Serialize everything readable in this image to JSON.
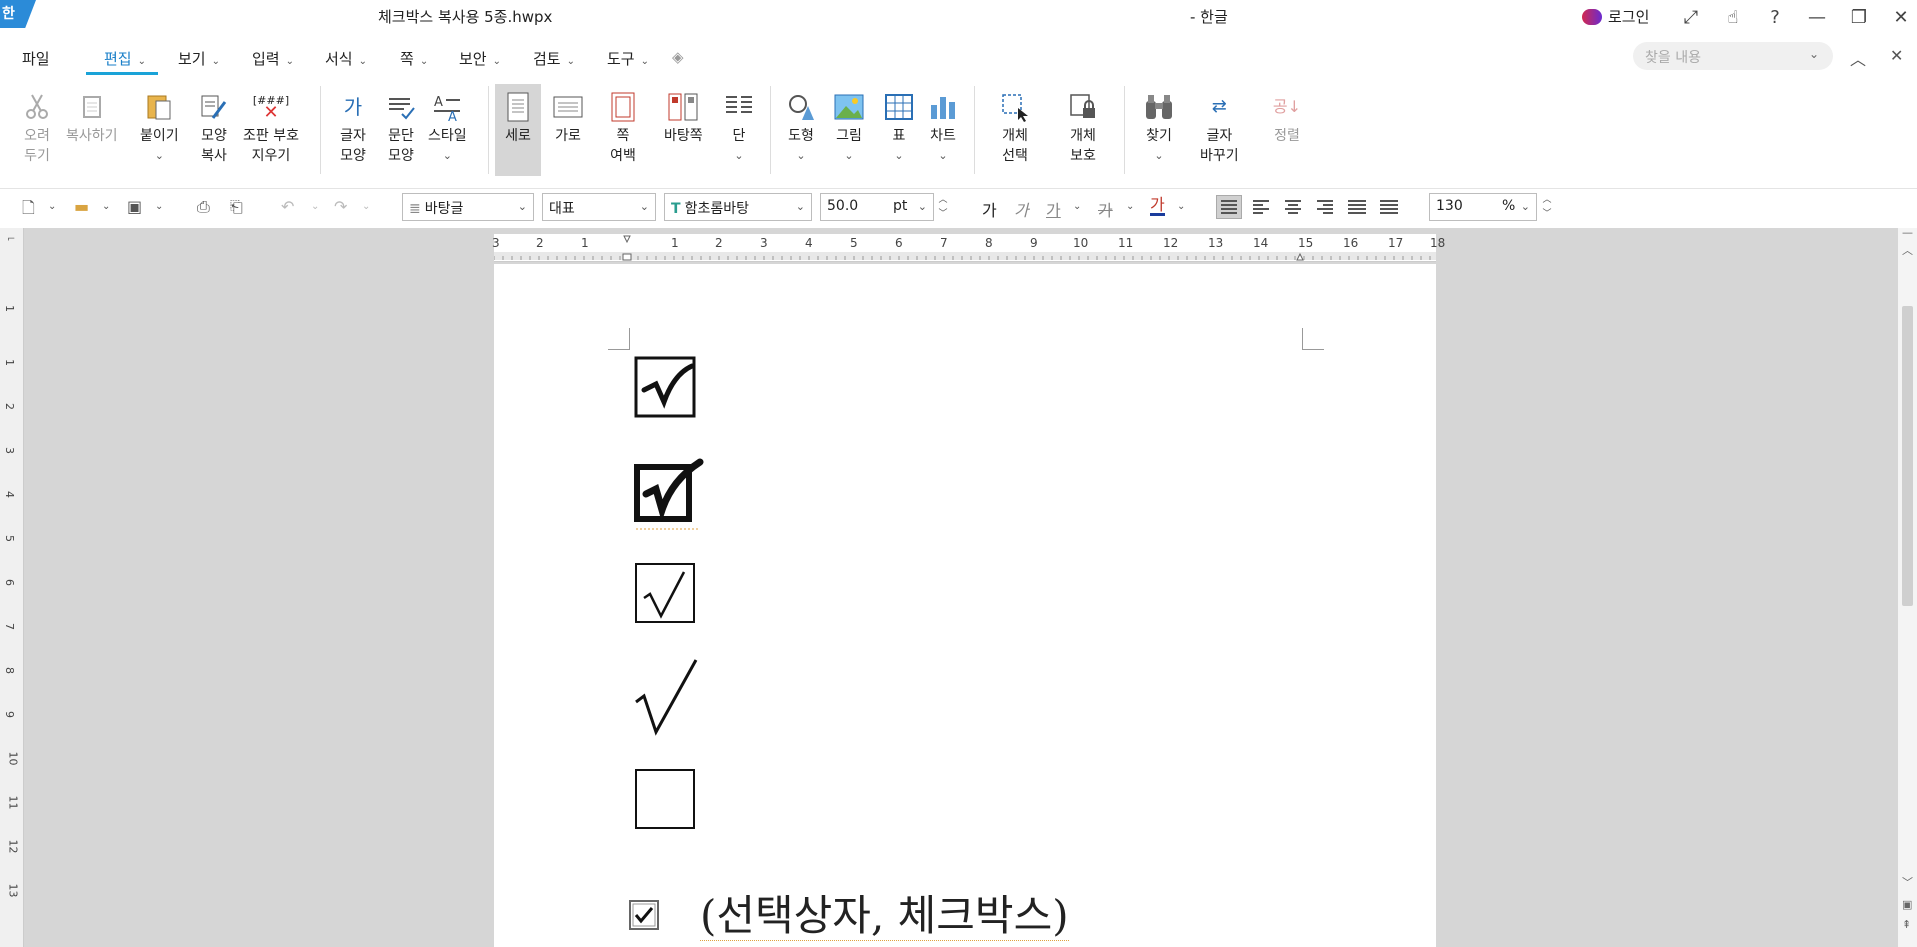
{
  "titlebar": {
    "app_badge": "한",
    "doc_title": "체크박스 복사용 5종.hwpx",
    "app_title": "- 한글",
    "login": "로그인",
    "buttons": [
      "⤢",
      "☝",
      "?",
      "—",
      "❐",
      "✕"
    ]
  },
  "menu": {
    "file": "파일",
    "items": [
      "편집",
      "보기",
      "입력",
      "서식",
      "쪽",
      "보안",
      "검토",
      "도구"
    ],
    "search_placeholder": "찾을 내용"
  },
  "ribbon": {
    "cut": [
      "오려",
      "두기"
    ],
    "copy": "복사하기",
    "paste": "붙이기",
    "format_copy": [
      "모양",
      "복사"
    ],
    "clear_code": [
      "조판 부호",
      "지우기"
    ],
    "char_shape": [
      "글자",
      "모양"
    ],
    "para_shape": [
      "문단",
      "모양"
    ],
    "style": "스타일",
    "portrait": "세로",
    "landscape": "가로",
    "page_margin": [
      "쪽",
      "여백"
    ],
    "background": "바탕쪽",
    "column": "단",
    "shape": "도형",
    "picture": "그림",
    "table": "표",
    "chart": "차트",
    "obj_select": [
      "개체",
      "선택"
    ],
    "obj_protect": [
      "개체",
      "보호"
    ],
    "find": "찾기",
    "char_change": [
      "글자",
      "바꾸기"
    ],
    "sort": "정렬",
    "clear_code_icon_text": "[###]",
    "char_icon_text": "가",
    "sort_icon_text": "공"
  },
  "format_bar": {
    "style": "바탕글",
    "lang": "대표",
    "font": "함초롬바탕",
    "size": "50.0",
    "unit": "pt",
    "bold": "가",
    "italic": "가",
    "underline": "가",
    "strike": "가",
    "color_char": "가",
    "zoom": "130",
    "zoom_unit": "%"
  },
  "ruler": {
    "h_labels": [
      "3",
      "2",
      "1",
      "1",
      "2",
      "3",
      "4",
      "5",
      "6",
      "7",
      "8",
      "9",
      "10",
      "11",
      "12",
      "13",
      "14",
      "15",
      "16",
      "17",
      "18"
    ],
    "v_labels": [
      "1",
      "1",
      "2",
      "3",
      "4",
      "5",
      "6",
      "7",
      "8",
      "9",
      "10",
      "11",
      "12",
      "13"
    ]
  },
  "document": {
    "caption": "(선택상자, 체크박스)"
  }
}
